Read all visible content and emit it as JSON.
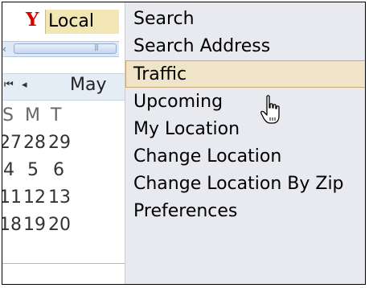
{
  "toolbar": {
    "logo_letter": "Y",
    "local_label": "Local"
  },
  "calendar": {
    "nav_first": "⏮",
    "nav_prev": "◂",
    "month_label": "May",
    "weekday_headers": [
      "S",
      "M",
      "T"
    ],
    "rows": [
      [
        "27",
        "28",
        "29"
      ],
      [
        "4",
        "5",
        "6"
      ],
      [
        "11",
        "12",
        "13"
      ],
      [
        "18",
        "19",
        "20"
      ]
    ]
  },
  "menu": {
    "items": [
      {
        "label": "Search"
      },
      {
        "label": "Search Address"
      },
      {
        "label": "Traffic",
        "highlighted": true
      },
      {
        "label": "Upcoming"
      },
      {
        "label": "My Location"
      },
      {
        "label": "Change Location"
      },
      {
        "label": "Change Location By Zip"
      },
      {
        "label": "Preferences"
      }
    ]
  },
  "colors": {
    "highlight_bg": "#efe3c8",
    "highlight_border": "#c8a770",
    "menu_bg": "#e8eaf0",
    "logo_red": "#d40000",
    "local_button_bg": "#f2e6b5"
  },
  "icons": {
    "cursor": "hand-pointer-icon",
    "scroll_left": "chevron-left-icon",
    "first": "skip-first-icon",
    "prev": "chevron-left-icon"
  }
}
